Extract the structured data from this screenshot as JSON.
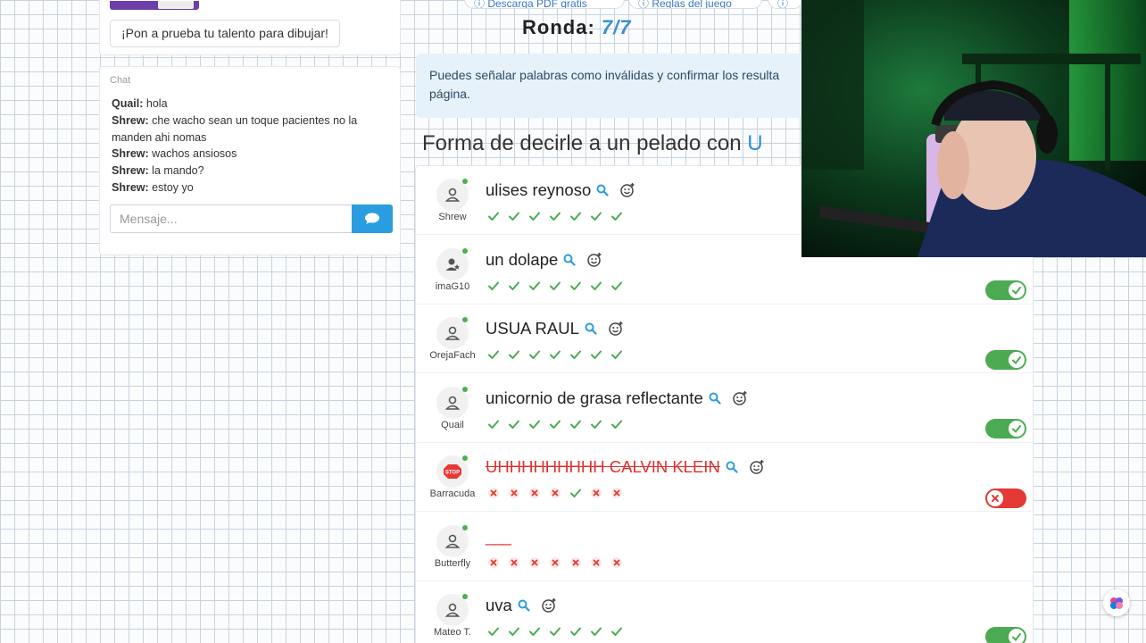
{
  "promo": {
    "button_label": "¡Pon a prueba tu talento para dibujar!"
  },
  "nav": {
    "download_label": "Descarga PDF gratis",
    "rules_label": "Reglas del juego"
  },
  "round": {
    "label": "Ronda:",
    "value": "7/7"
  },
  "chat": {
    "header": "Chat",
    "messages": [
      {
        "author": "Quail:",
        "text": "hola"
      },
      {
        "author": "Shrew:",
        "text": "che wacho sean un toque pacientes no la manden ahi nomas"
      },
      {
        "author": "Shrew:",
        "text": "wachos ansiosos"
      },
      {
        "author": "Shrew:",
        "text": "la mando?"
      },
      {
        "author": "Shrew:",
        "text": "estoy yo"
      }
    ],
    "input_placeholder": "Mensaje..."
  },
  "info_banner": "Puedes señalar palabras como inválidas y confirmar los resulta página.",
  "category": {
    "title": "Forma de decirle a un pelado con",
    "letter": "U"
  },
  "answers": [
    {
      "player": "Shrew",
      "text": "ulises reynoso",
      "status": "valid",
      "votes": [
        "yes",
        "yes",
        "yes",
        "yes",
        "yes",
        "yes",
        "yes"
      ],
      "toggle": "hidden",
      "avatar": "user-icon"
    },
    {
      "player": "imaG10",
      "text": "un dolape",
      "status": "valid",
      "votes": [
        "yes",
        "yes",
        "yes",
        "yes",
        "yes",
        "yes",
        "yes"
      ],
      "toggle": "on",
      "avatar": "user-star-icon"
    },
    {
      "player": "OrejaFach",
      "text": "USUA RAUL",
      "status": "valid",
      "votes": [
        "yes",
        "yes",
        "yes",
        "yes",
        "yes",
        "yes",
        "yes"
      ],
      "toggle": "on",
      "avatar": "user-icon"
    },
    {
      "player": "Quail",
      "text": "unicornio de grasa reflectante",
      "status": "valid",
      "votes": [
        "yes",
        "yes",
        "yes",
        "yes",
        "yes",
        "yes",
        "yes"
      ],
      "toggle": "on",
      "avatar": "user-icon"
    },
    {
      "player": "Barracuda",
      "text": "UHHHHHHHHH CALVIN KLEIN",
      "status": "invalid",
      "votes": [
        "no",
        "no",
        "no",
        "no",
        "yes",
        "no",
        "no"
      ],
      "toggle": "off",
      "avatar": "stop-sign-icon"
    },
    {
      "player": "Butterfly",
      "text": "___",
      "status": "empty",
      "votes": [
        "no",
        "no",
        "no",
        "no",
        "no",
        "no",
        "no"
      ],
      "toggle": "hidden",
      "avatar": "user-icon"
    },
    {
      "player": "Mateo T.",
      "text": "uva",
      "status": "valid",
      "votes": [
        "yes",
        "yes",
        "yes",
        "yes",
        "yes",
        "yes",
        "yes"
      ],
      "toggle": "on",
      "avatar": "user-icon"
    }
  ],
  "colors": {
    "accent": "#2a9de0",
    "valid": "#4cab52",
    "invalid": "#e53935"
  }
}
